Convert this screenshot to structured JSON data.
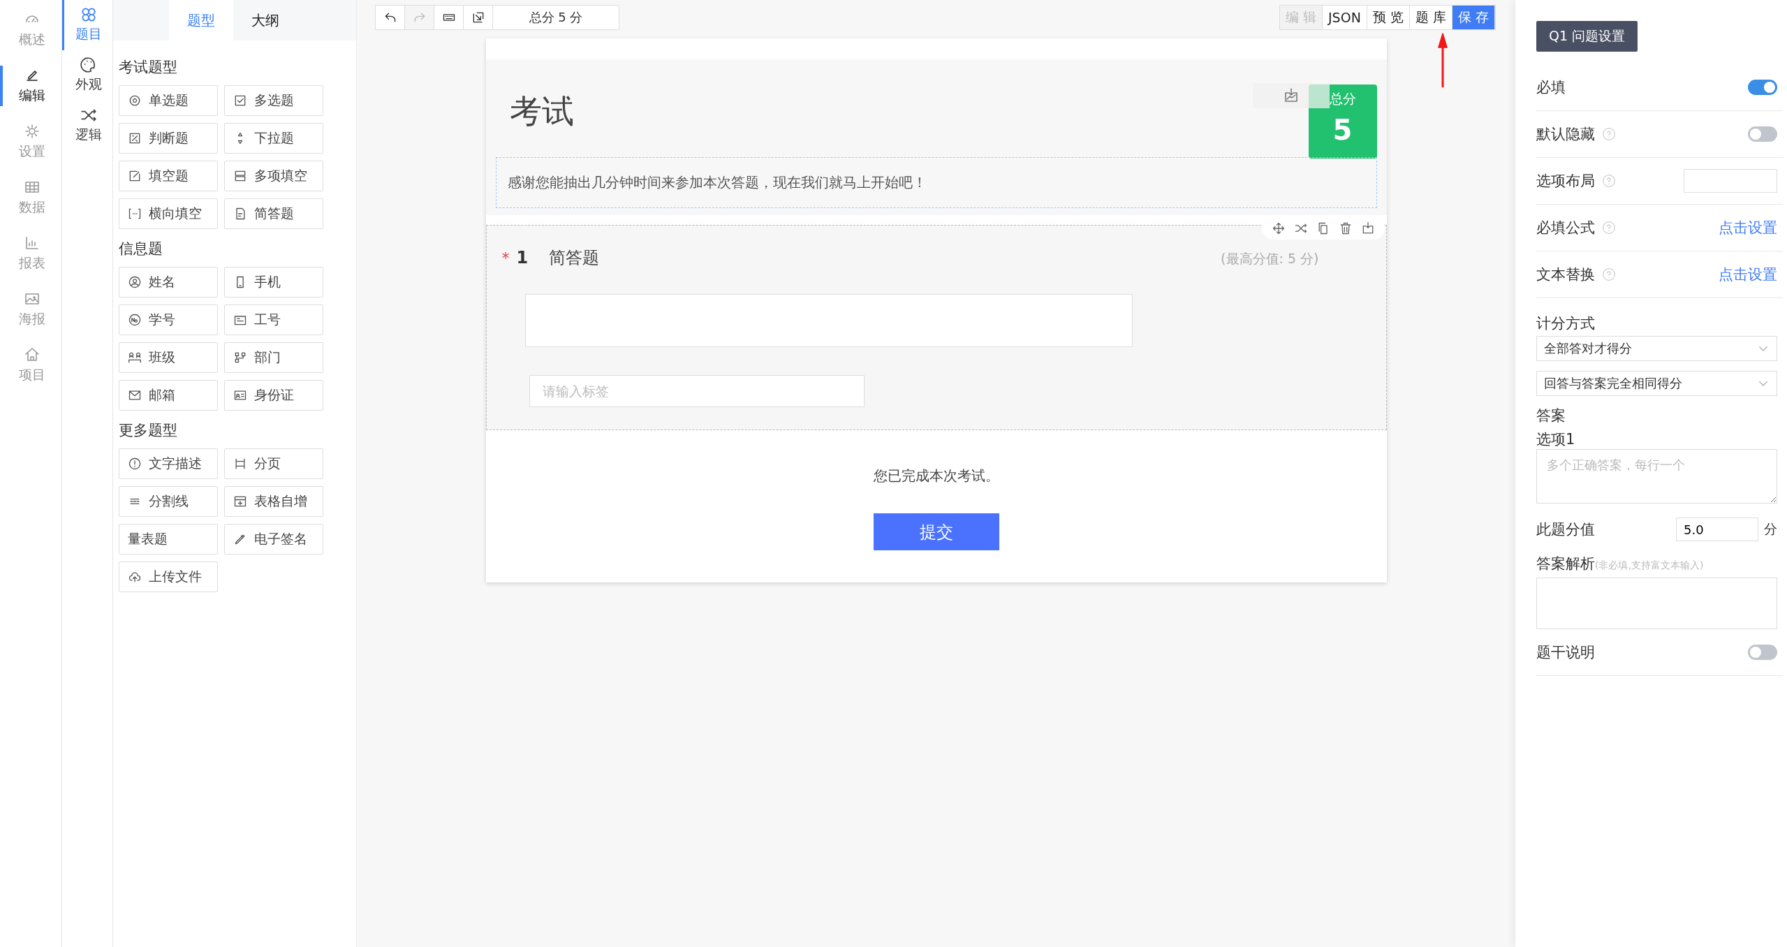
{
  "nav": [
    {
      "label": "概述",
      "selected": false
    },
    {
      "label": "编辑",
      "selected": true
    },
    {
      "label": "设置",
      "selected": false
    },
    {
      "label": "数据",
      "selected": false
    },
    {
      "label": "报表",
      "selected": false
    },
    {
      "label": "海报",
      "selected": false
    },
    {
      "label": "项目",
      "selected": false
    }
  ],
  "subnav": [
    {
      "label": "题目",
      "selected": true
    },
    {
      "label": "外观",
      "selected": false
    },
    {
      "label": "逻辑",
      "selected": false
    }
  ],
  "panel_tabs": [
    {
      "label": "题型",
      "selected": true
    },
    {
      "label": "大纲",
      "selected": false
    }
  ],
  "groups": [
    {
      "title": "考试题型",
      "items": [
        "单选题",
        "多选题",
        "判断题",
        "下拉题",
        "填空题",
        "多项填空",
        "横向填空",
        "简答题"
      ]
    },
    {
      "title": "信息题",
      "items": [
        "姓名",
        "手机",
        "学号",
        "工号",
        "班级",
        "部门",
        "邮箱",
        "身份证"
      ]
    },
    {
      "title": "更多题型",
      "items": [
        "文字描述",
        "分页",
        "分割线",
        "表格自增",
        "量表题",
        "电子签名",
        "上传文件"
      ]
    }
  ],
  "toolbar": {
    "total": "总分 5 分",
    "buttons": [
      {
        "label": "编 辑",
        "disabled": true,
        "selected": false
      },
      {
        "label": "JSON",
        "disabled": false,
        "selected": false
      },
      {
        "label": "预 览",
        "disabled": false,
        "selected": false
      },
      {
        "label": "题 库",
        "disabled": false,
        "selected": false
      },
      {
        "label": "保 存",
        "disabled": false,
        "selected": true
      }
    ]
  },
  "form": {
    "title": "考试",
    "score_label": "总分",
    "score": "5",
    "description": "感谢您能抽出几分钟时间来参加本次答题，现在我们就马上开始吧！",
    "question": {
      "required": true,
      "required_mark": "*",
      "number": "1",
      "title": "简答题",
      "max_score": "(最高分值: 5 分)",
      "tag_placeholder": "请输入标签"
    },
    "end_text": "您已完成本次考试。",
    "submit": "提交"
  },
  "settings": {
    "header": "Q1 问题设置",
    "rows": [
      {
        "kind": "toggle",
        "label": "必填",
        "help": false,
        "on": true
      },
      {
        "kind": "toggle",
        "label": "默认隐藏",
        "help": true,
        "on": false
      },
      {
        "kind": "input",
        "label": "选项布局",
        "help": true
      },
      {
        "kind": "link",
        "label": "必填公式",
        "help": true,
        "link": "点击设置"
      },
      {
        "kind": "link",
        "label": "文本替换",
        "help": true,
        "link": "点击设置"
      }
    ],
    "scoring_label": "计分方式",
    "selects": [
      "全部答对才得分",
      "回答与答案完全相同得分"
    ],
    "answer_label": "答案",
    "option_label": "选项1",
    "answer_placeholder": "多个正确答案，每行一个",
    "score_label": "此题分值",
    "score_value": "5.0",
    "score_unit": "分",
    "analysis_label": "答案解析",
    "analysis_hint": "(非必填,支持富文本输入)",
    "stem_label": "题干说明",
    "stem_on": false
  }
}
